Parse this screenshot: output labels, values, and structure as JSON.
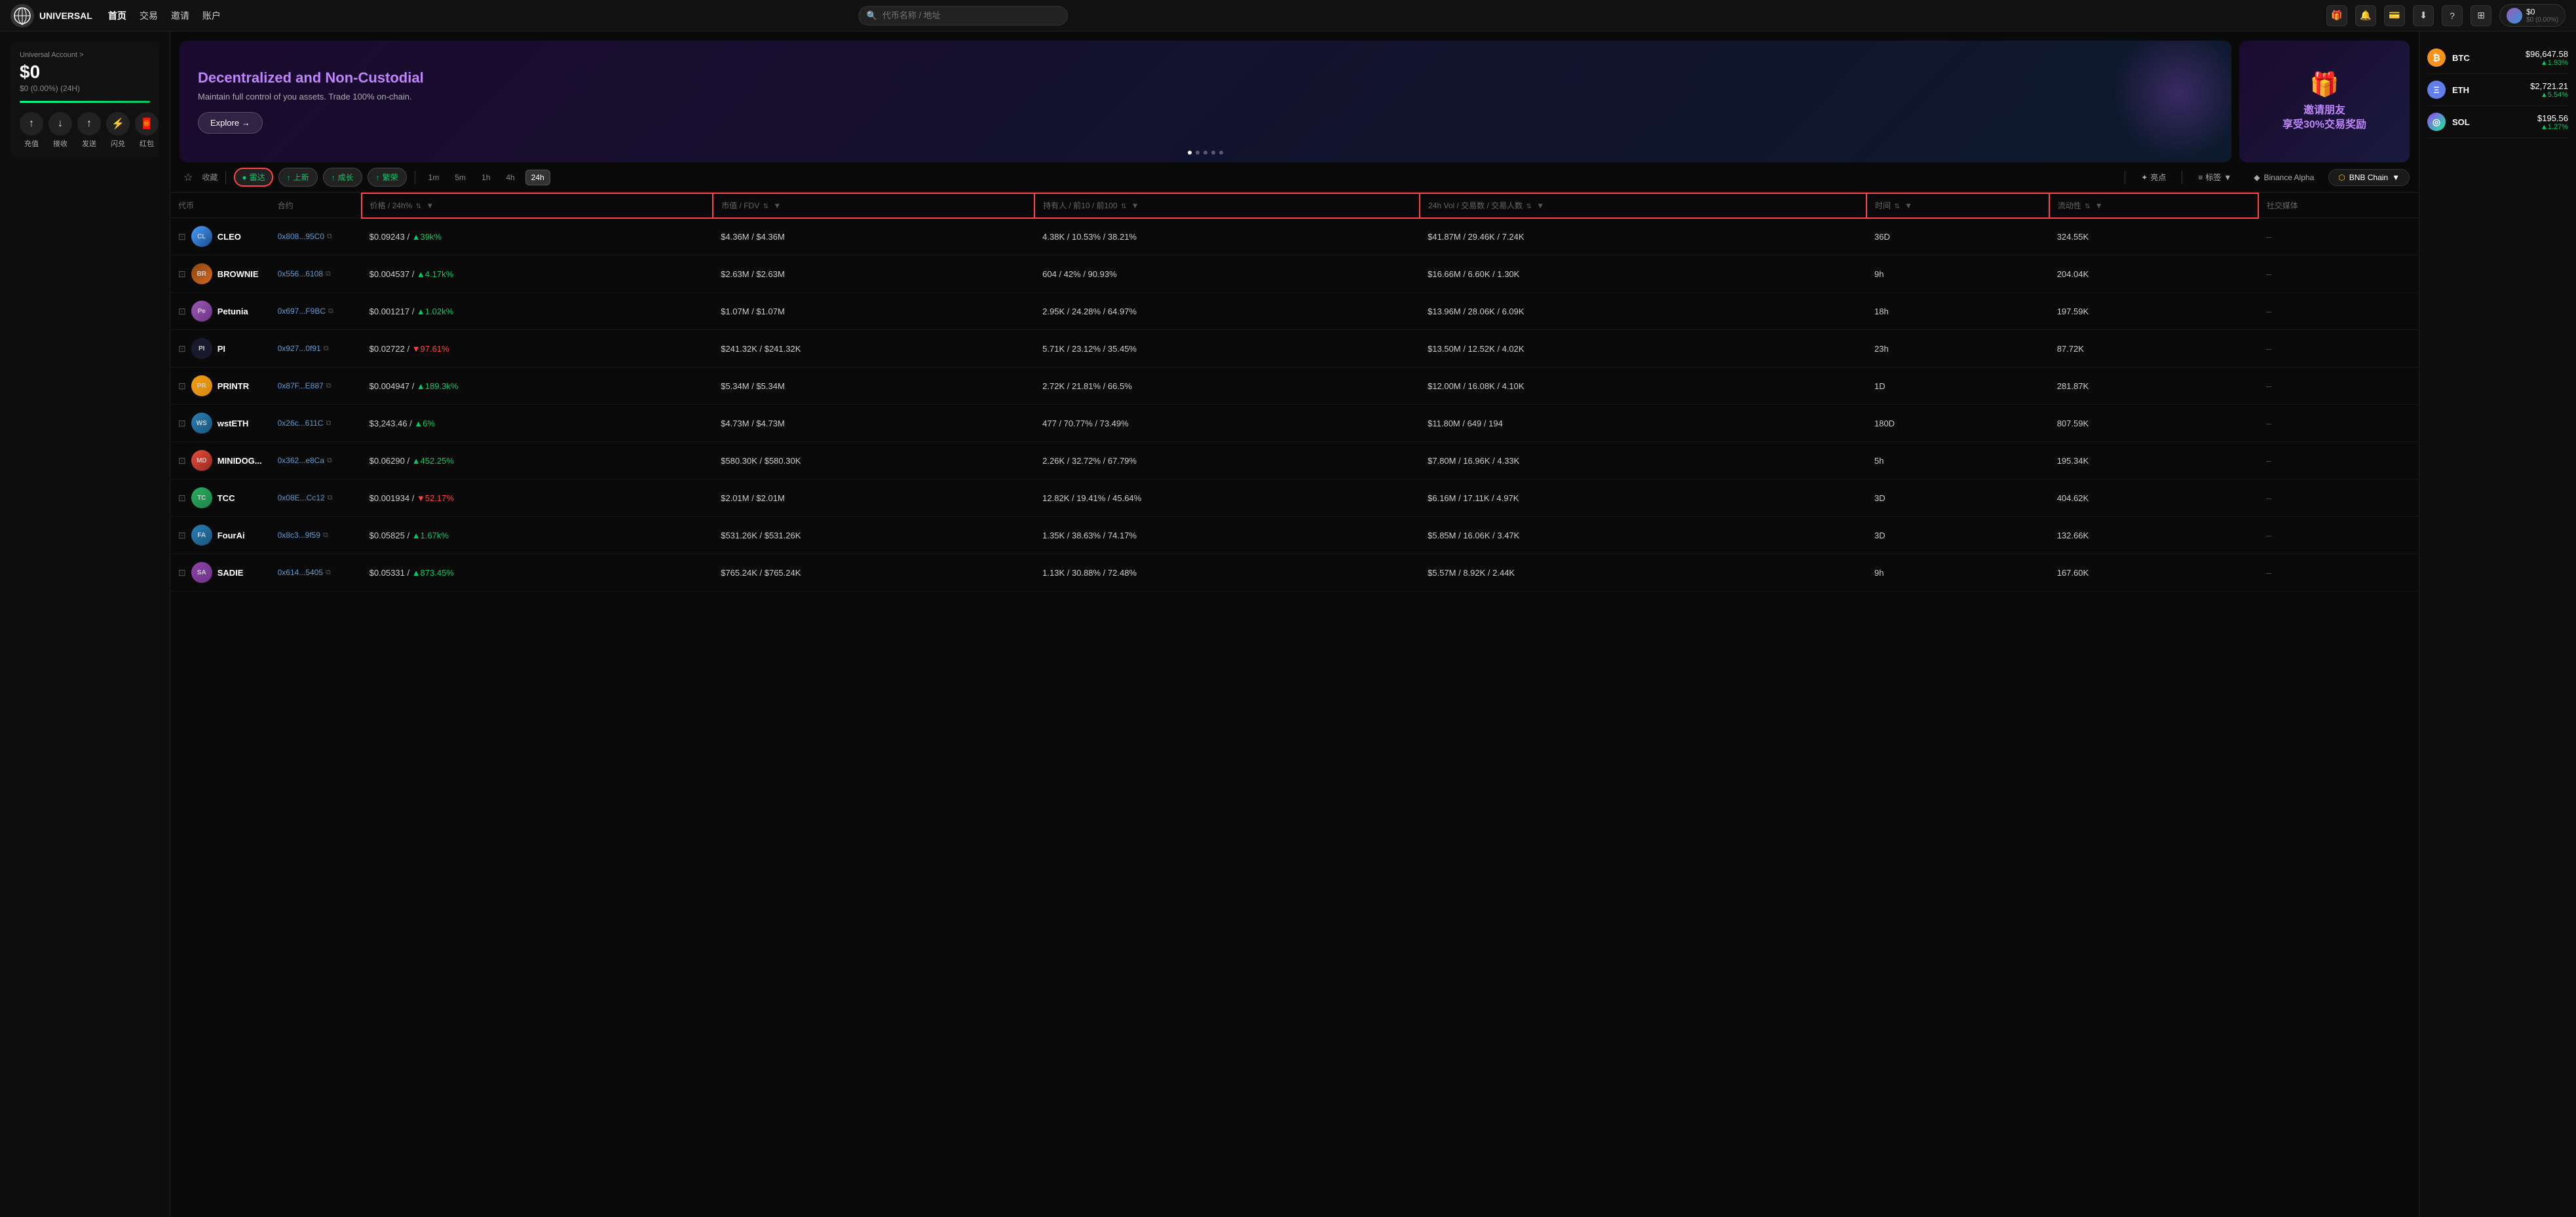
{
  "app": {
    "name": "UNIVERSAL",
    "logo_text": "UNIVERSAL"
  },
  "nav": {
    "links": [
      {
        "label": "首页",
        "active": true
      },
      {
        "label": "交易",
        "active": false
      },
      {
        "label": "邀请",
        "active": false
      },
      {
        "label": "账户",
        "active": false
      }
    ],
    "search_placeholder": "代币名称 / 地址",
    "icons": [
      "gift",
      "bell",
      "wallet",
      "download",
      "question",
      "grid"
    ],
    "user": {
      "balance": "$0",
      "change": "$0 (0.00%)"
    }
  },
  "account": {
    "label": "Universal Account >",
    "balance": "$0",
    "change_24h": "$0 (0.00%) (24H)",
    "actions": [
      {
        "icon": "↑",
        "label": "充值"
      },
      {
        "icon": "↓",
        "label": "接收"
      },
      {
        "icon": "↑",
        "label": "发送"
      },
      {
        "icon": "⚡",
        "label": "闪兑"
      },
      {
        "icon": "🧧",
        "label": "红包"
      }
    ]
  },
  "banner": {
    "title_plain": "Decentralized and ",
    "title_highlight": "Non-Custodial",
    "subtitle": "Maintain full control of you assets. Trade 100% on-chain.",
    "explore_btn": "Explore →",
    "dots": [
      true,
      false,
      false,
      false,
      false
    ]
  },
  "invite": {
    "text_line1": "邀请朋友",
    "text_line2": "享受",
    "highlight": "30%",
    "text_line3": "交易奖励"
  },
  "crypto_prices": [
    {
      "name": "BTC",
      "icon_type": "btc",
      "price": "$96,647.58",
      "change": "▲1.93%",
      "up": true
    },
    {
      "name": "ETH",
      "icon_type": "eth",
      "price": "$2,721.21",
      "change": "▲5.54%",
      "up": true
    },
    {
      "name": "SOL",
      "icon_type": "sol",
      "price": "$195.56",
      "change": "▲1.27%",
      "up": true
    }
  ],
  "filter_bar": {
    "star_label": "收藏",
    "chips": [
      {
        "label": "雷达",
        "active": true,
        "color": "lei"
      },
      {
        "label": "上新",
        "active": false
      },
      {
        "label": "成长",
        "active": false
      },
      {
        "label": "繁荣",
        "active": false
      }
    ],
    "times": [
      {
        "label": "1m",
        "active": false
      },
      {
        "label": "5m",
        "active": false
      },
      {
        "label": "1h",
        "active": false
      },
      {
        "label": "4h",
        "active": false
      },
      {
        "label": "24h",
        "active": true
      }
    ],
    "right_buttons": [
      {
        "label": "亮点"
      },
      {
        "label": "标签"
      },
      {
        "label": "Binance Alpha"
      }
    ],
    "chain_btn": "BNB Chain"
  },
  "table": {
    "headers": [
      {
        "label": "代币",
        "sortable": false
      },
      {
        "label": "合约",
        "sortable": false
      },
      {
        "label": "价格 / 24h%",
        "sortable": true
      },
      {
        "label": "市值 / FDV",
        "sortable": true
      },
      {
        "label": "持有人 / 前10 / 前100",
        "sortable": true
      },
      {
        "label": "24h Vol / 交易数 / 交易人数",
        "sortable": true
      },
      {
        "label": "时间",
        "sortable": true
      },
      {
        "label": "流动性",
        "sortable": true
      },
      {
        "label": "社交媒体",
        "sortable": false
      }
    ],
    "rows": [
      {
        "name": "CLEO",
        "avatar": "cleo",
        "avatar_text": "CL",
        "contract": "0x808...95C0",
        "price": "$0.09243",
        "change_24h": "▲39k%",
        "change_up": true,
        "market_cap": "$4.36M / $4.36M",
        "holders": "4.38K / 10.53% / 38.21%",
        "vol_24h": "$41.87M / 29.46K / 7.24K",
        "time": "36D",
        "liquidity": "324.55K",
        "social": "--"
      },
      {
        "name": "BROWNIE",
        "avatar": "brownie",
        "avatar_text": "BR",
        "contract": "0x556...6108",
        "price": "$0.004537",
        "change_24h": "▲4.17k%",
        "change_up": true,
        "market_cap": "$2.63M / $2.63M",
        "holders": "604 / 42% / 90.93%",
        "vol_24h": "$16.66M / 6.60K / 1.30K",
        "time": "9h",
        "liquidity": "204.04K",
        "social": "--"
      },
      {
        "name": "Petunia",
        "avatar": "petunia",
        "avatar_text": "Pe",
        "contract": "0x697...F9BC",
        "price": "$0.001217",
        "change_24h": "▲1.02k%",
        "change_up": true,
        "market_cap": "$1.07M / $1.07M",
        "holders": "2.95K / 24.28% / 64.97%",
        "vol_24h": "$13.96M / 28.06K / 6.09K",
        "time": "18h",
        "liquidity": "197.59K",
        "social": "--"
      },
      {
        "name": "PI",
        "avatar": "pi",
        "avatar_text": "PI",
        "contract": "0x927...0f91",
        "price": "$0.02722",
        "change_24h": "▼97.61%",
        "change_up": false,
        "market_cap": "$241.32K / $241.32K",
        "holders": "5.71K / 23.12% / 35.45%",
        "vol_24h": "$13.50M / 12.52K / 4.02K",
        "time": "23h",
        "liquidity": "87.72K",
        "social": "--"
      },
      {
        "name": "PRINTR",
        "avatar": "printr",
        "avatar_text": "PR",
        "contract": "0x87F...E887",
        "price": "$0.004947",
        "change_24h": "▲189.3k%",
        "change_up": true,
        "market_cap": "$5.34M / $5.34M",
        "holders": "2.72K / 21.81% / 66.5%",
        "vol_24h": "$12.00M / 16.08K / 4.10K",
        "time": "1D",
        "liquidity": "281.87K",
        "social": "--"
      },
      {
        "name": "wstETH",
        "avatar": "wsteth",
        "avatar_text": "WS",
        "contract": "0x26c...611C",
        "price": "$3,243.46",
        "change_24h": "▲6%",
        "change_up": true,
        "market_cap": "$4.73M / $4.73M",
        "holders": "477 / 70.77% / 73.49%",
        "vol_24h": "$11.80M / 649 / 194",
        "time": "180D",
        "liquidity": "807.59K",
        "social": "--"
      },
      {
        "name": "MINIDOG...",
        "avatar": "minidog",
        "avatar_text": "MD",
        "contract": "0x362...e8Ca",
        "price": "$0.06290",
        "change_24h": "▲452.25%",
        "change_up": true,
        "market_cap": "$580.30K / $580.30K",
        "holders": "2.26K / 32.72% / 67.79%",
        "vol_24h": "$7.80M / 16.96K / 4.33K",
        "time": "5h",
        "liquidity": "195.34K",
        "social": "--"
      },
      {
        "name": "TCC",
        "avatar": "tcc",
        "avatar_text": "TC",
        "contract": "0x08E...Cc12",
        "price": "$0.001934",
        "change_24h": "▼52.17%",
        "change_up": false,
        "market_cap": "$2.01M / $2.01M",
        "holders": "12.82K / 19.41% / 45.64%",
        "vol_24h": "$6.16M / 17.11K / 4.97K",
        "time": "3D",
        "liquidity": "404.62K",
        "social": "--"
      },
      {
        "name": "FourAi",
        "avatar": "fourai",
        "avatar_text": "FA",
        "contract": "0x8c3...9f59",
        "price": "$0.05825",
        "change_24h": "▲1.67k%",
        "change_up": true,
        "market_cap": "$531.26K / $531.26K",
        "holders": "1.35K / 38.63% / 74.17%",
        "vol_24h": "$5.85M / 16.06K / 3.47K",
        "time": "3D",
        "liquidity": "132.66K",
        "social": "--"
      },
      {
        "name": "SADIE",
        "avatar": "sadie",
        "avatar_text": "SA",
        "contract": "0x614...5405",
        "price": "$0.05331",
        "change_24h": "▲873.45%",
        "change_up": true,
        "market_cap": "$765.24K / $765.24K",
        "holders": "1.13K / 30.88% / 72.48%",
        "vol_24h": "$5.57M / 8.92K / 2.44K",
        "time": "9h",
        "liquidity": "167.60K",
        "social": "--"
      }
    ]
  }
}
